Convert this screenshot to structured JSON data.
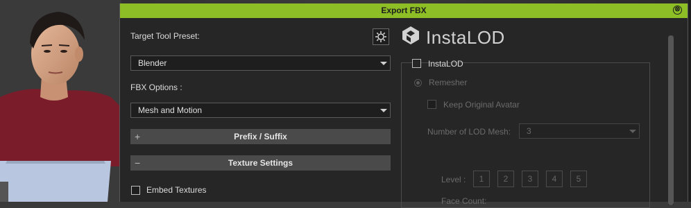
{
  "dialog": {
    "title": "Export FBX",
    "close_glyph": "⊗",
    "target_tool_preset_label": "Target Tool Preset:",
    "target_tool_preset_value": "Blender",
    "fbx_options_label": "FBX Options :",
    "fbx_options_value": "Mesh and Motion",
    "sections": [
      {
        "sign": "+",
        "label": "Prefix / Suffix"
      },
      {
        "sign": "−",
        "label": "Texture Settings"
      }
    ],
    "embed_textures_label": "Embed Textures",
    "gear_icon": "gear-icon"
  },
  "instalod": {
    "logo_text": "InstaLOD",
    "checkbox_label": "InstaLOD",
    "remesher_label": "Remesher",
    "keep_original_label": "Keep Original Avatar",
    "lod_mesh_label": "Number of LOD Mesh:",
    "lod_mesh_value": "3",
    "level_label": "Level :",
    "levels": [
      "1",
      "2",
      "3",
      "4",
      "5"
    ],
    "face_count_label": "Face Count:"
  },
  "colors": {
    "titlebar": "#8dbe25",
    "dialog_bg": "#262626",
    "section_bg": "#4a4a4a"
  }
}
